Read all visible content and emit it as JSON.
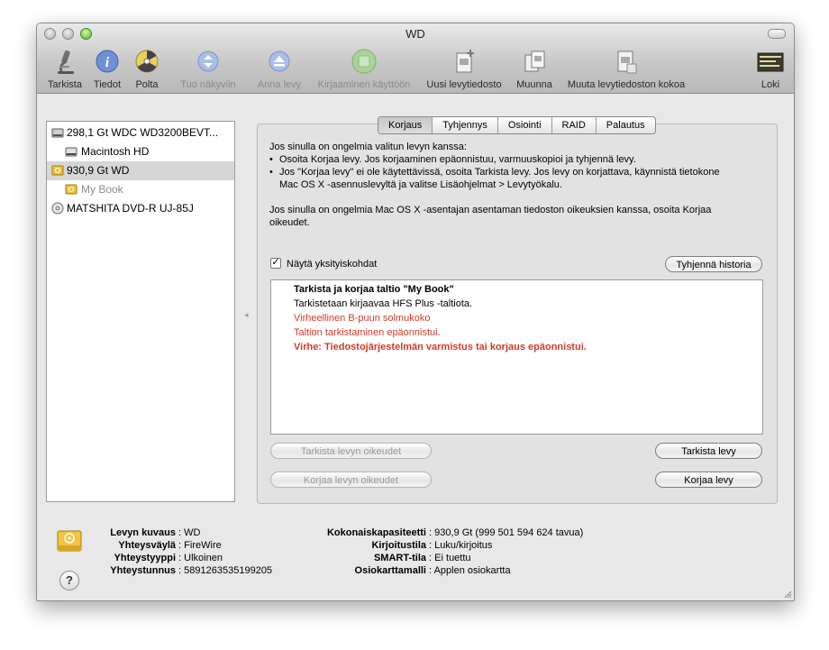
{
  "window": {
    "title": "WD"
  },
  "toolbar": {
    "items": [
      {
        "label": "Tarkista",
        "icon": "microscope-icon"
      },
      {
        "label": "Tiedot",
        "icon": "info-icon"
      },
      {
        "label": "Polta",
        "icon": "burn-icon"
      },
      {
        "label": "Tuo näkyviin",
        "icon": "mount-icon"
      },
      {
        "label": "Anna levy",
        "icon": "eject-icon"
      },
      {
        "label": "Kirjaaminen käyttöön",
        "icon": "journaling-icon"
      },
      {
        "label": "Uusi levytiedosto",
        "icon": "new-image-icon"
      },
      {
        "label": "Muunna",
        "icon": "convert-icon"
      },
      {
        "label": "Muuta levytiedoston kokoa",
        "icon": "resize-image-icon"
      },
      {
        "label": "Loki",
        "icon": "log-icon"
      }
    ]
  },
  "sidebar": {
    "items": [
      {
        "label": "298,1 Gt WDC WD3200BEVT...",
        "icon": "internal-disk-icon"
      },
      {
        "label": "Macintosh HD",
        "icon": "volume-icon"
      },
      {
        "label": "930,9 Gt WD",
        "icon": "firewire-disk-icon"
      },
      {
        "label": "My Book",
        "icon": "firewire-volume-icon"
      },
      {
        "label": "MATSHITA DVD-R UJ-85J",
        "icon": "optical-drive-icon"
      }
    ]
  },
  "tabs": [
    "Korjaus",
    "Tyhjennys",
    "Osiointi",
    "RAID",
    "Palautus"
  ],
  "active_tab": "Korjaus",
  "info": {
    "intro": "Jos sinulla on ongelmia valitun levyn kanssa:",
    "bullet1": "Osoita Korjaa levy. Jos korjaaminen epäonnistuu, varmuuskopioi ja tyhjennä levy.",
    "bullet2a": "Jos \"Korjaa levy\" ei ole käytettävissä, osoita Tarkista levy. Jos levy on korjattava, käynnistä tietokone",
    "bullet2b": "Mac OS X -asennuslevyltä ja valitse Lisäohjelmat > Levytyökalu.",
    "perm_a": "Jos sinulla on ongelmia Mac OS X -asentajan asentaman tiedoston oikeuksien kanssa, osoita Korjaa",
    "perm_b": "oikeudet."
  },
  "details": {
    "checkbox_label": "Näytä yksityiskohdat",
    "checked_mark": "✓",
    "clear_history": "Tyhjennä historia"
  },
  "log": [
    {
      "text": "Tarkista ja korjaa taltio \"My Book\"",
      "style": "bold"
    },
    {
      "text": "Tarkistetaan kirjaavaa HFS Plus -taltiota.",
      "style": "normal"
    },
    {
      "text": "Virheellinen B-puun solmukoko",
      "style": "red"
    },
    {
      "text": "Taltion tarkistaminen epäonnistui.",
      "style": "red"
    },
    {
      "text": "Virhe: Tiedostojärjestelmän varmistus tai korjaus epäonnistui.",
      "style": "redbold"
    }
  ],
  "buttons": {
    "verify_permissions": "Tarkista levyn oikeudet",
    "repair_permissions": "Korjaa levyn oikeudet",
    "verify_disk": "Tarkista levy",
    "repair_disk": "Korjaa levy"
  },
  "disk_info": {
    "left": [
      {
        "key": "Levyn kuvaus",
        "value": "WD"
      },
      {
        "key": "Yhteysväylä",
        "value": "FireWire"
      },
      {
        "key": "Yhteystyyppi",
        "value": "Ulkoinen"
      },
      {
        "key": "Yhteystunnus",
        "value": "5891263535199205"
      }
    ],
    "right": [
      {
        "key": "Kokonaiskapasiteetti",
        "value": "930,9 Gt (999 501 594 624 tavua)"
      },
      {
        "key": "Kirjoitustila",
        "value": "Luku/kirjoitus"
      },
      {
        "key": "SMART-tila",
        "value": "Ei tuettu"
      },
      {
        "key": "Osiokarttamalli",
        "value": "Applen osiokartta"
      }
    ]
  },
  "help": "?"
}
